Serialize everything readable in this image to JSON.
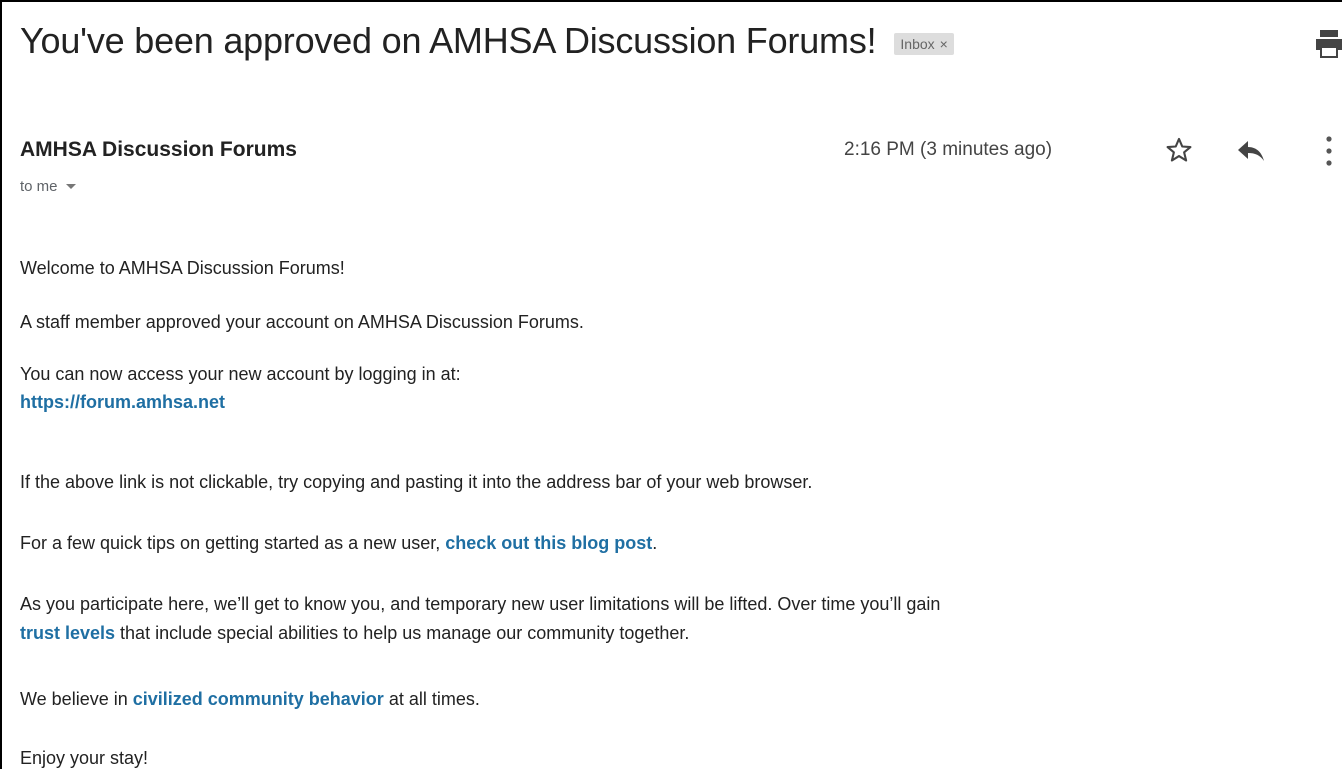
{
  "email": {
    "subject": "You've been approved on AMHSA Discussion Forums!",
    "label": "Inbox",
    "label_close": "×",
    "sender": "AMHSA Discussion Forums",
    "recipient": "to me",
    "timestamp": "2:16 PM (3 minutes ago)"
  },
  "icons": {
    "print": "print-icon",
    "star": "star-icon",
    "reply": "reply-icon",
    "more": "more-vert-icon",
    "caret": "chevron-down-icon"
  },
  "body": {
    "welcome": "Welcome to AMHSA Discussion Forums!",
    "approved": "A staff member approved your account on AMHSA Discussion Forums.",
    "access": "You can now access your new account by logging in at:",
    "login_link": "https://forum.amhsa.net",
    "not_clickable": "If the above link is not clickable, try copying and pasting it into the address bar of your web browser.",
    "tips_prefix": "For a few quick tips on getting started as a new user, ",
    "tips_link": "check out this blog post",
    "tips_suffix": ".",
    "participate_line1": "As you participate here, we’ll get to know you, and temporary new user limitations will be lifted. Over time you’ll gain",
    "trust_link": "trust levels",
    "participate_line2_suffix": " that include special abilities to help us manage our community together.",
    "believe_prefix": "We believe in ",
    "civilized_link": "civilized community behavior",
    "believe_suffix": " at all times.",
    "enjoy": "Enjoy your stay!"
  },
  "colors": {
    "link": "#1f6fa3",
    "label_bg": "#dddddd"
  }
}
